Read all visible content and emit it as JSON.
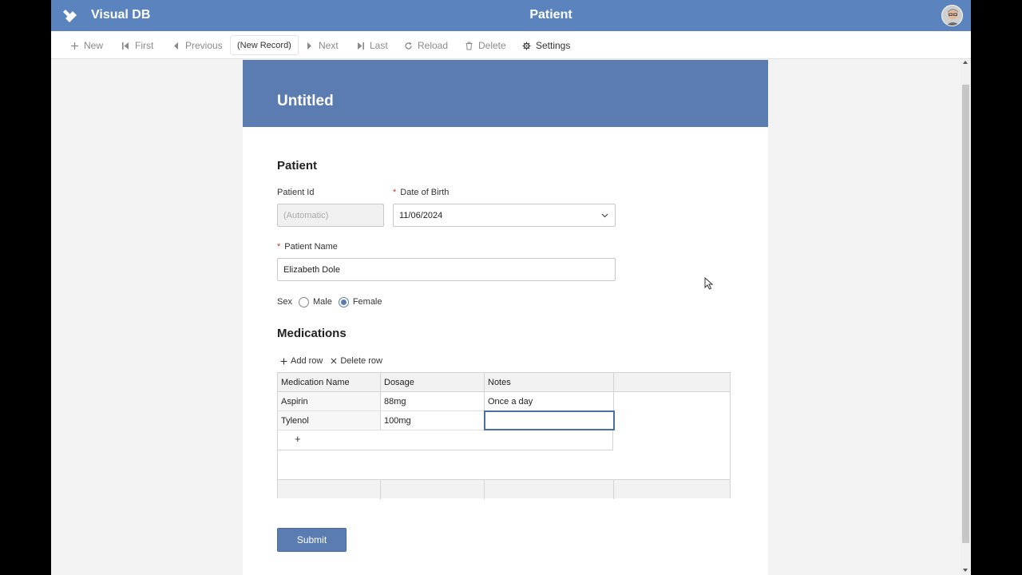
{
  "header": {
    "app_name": "Visual DB",
    "title": "Patient"
  },
  "toolbar": {
    "new": "New",
    "first": "First",
    "previous": "Previous",
    "record": "(New Record)",
    "next": "Next",
    "last": "Last",
    "reload": "Reload",
    "delete": "Delete",
    "settings": "Settings"
  },
  "form": {
    "title": "Untitled",
    "section_patient": "Patient",
    "patient_id_label": "Patient Id",
    "patient_id_placeholder": "(Automatic)",
    "dob_label": "Date of Birth",
    "dob_value": "11/06/2024",
    "name_label": "Patient Name",
    "name_value": "Elizabeth Dole",
    "sex_label": "Sex",
    "sex_options": [
      "Male",
      "Female"
    ],
    "sex_selected": "Female",
    "section_medications": "Medications",
    "add_row": "Add row",
    "delete_row": "Delete row",
    "columns": [
      "Medication Name",
      "Dosage",
      "Notes"
    ],
    "rows": [
      [
        "Aspirin",
        "88mg",
        "Once a day"
      ],
      [
        "Tylenol",
        "100mg",
        ""
      ]
    ],
    "add_glyph": "+",
    "submit": "Submit"
  },
  "colors": {
    "brand": "#5b84bf",
    "header_card": "#5b7cb0",
    "required": "#c0392b"
  }
}
